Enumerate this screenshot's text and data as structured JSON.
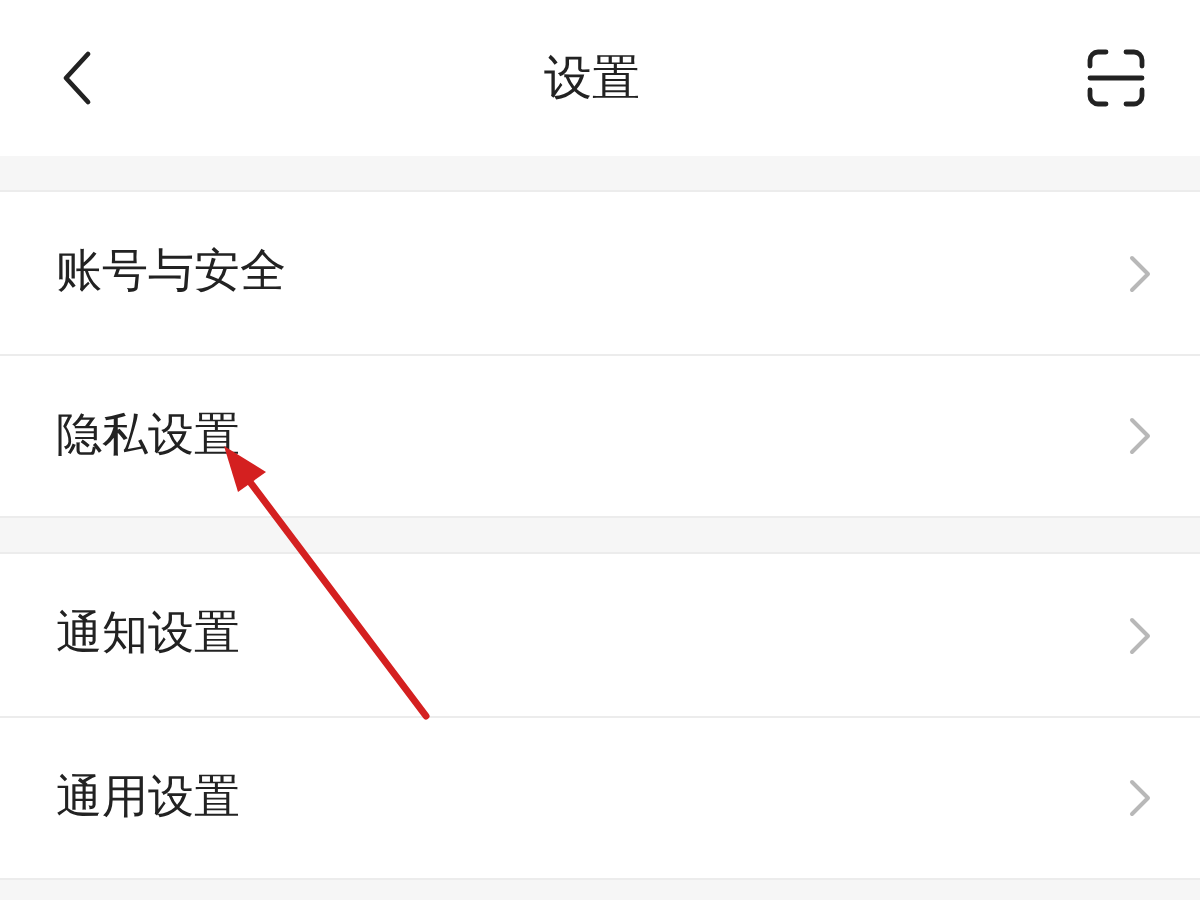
{
  "header": {
    "title": "设置"
  },
  "groups": [
    {
      "items": [
        {
          "label": "账号与安全"
        },
        {
          "label": "隐私设置"
        }
      ]
    },
    {
      "items": [
        {
          "label": "通知设置"
        },
        {
          "label": "通用设置"
        }
      ]
    }
  ]
}
